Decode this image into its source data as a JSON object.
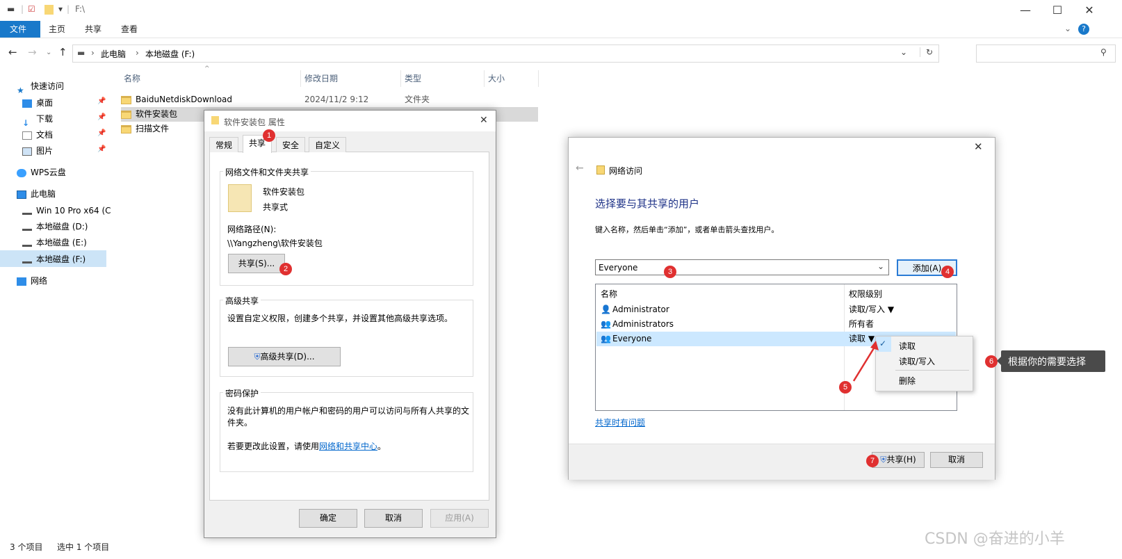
{
  "titlebar": {
    "path": "F:\\",
    "minimize": "—",
    "maximize": "☐",
    "close": "✕"
  },
  "ribbon": {
    "tabs": [
      "文件",
      "主页",
      "共享",
      "查看"
    ]
  },
  "address": {
    "crumbs": [
      "此电脑",
      "本地磁盘 (F:)"
    ]
  },
  "nav": {
    "quick_access": "快速访问",
    "items": [
      "桌面",
      "下载",
      "文档",
      "图片"
    ],
    "wps": "WPS云盘",
    "this_pc": "此电脑",
    "drives": [
      "Win 10 Pro x64 (C",
      "本地磁盘 (D:)",
      "本地磁盘 (E:)",
      "本地磁盘 (F:)"
    ],
    "network": "网络"
  },
  "columns": [
    "名称",
    "修改日期",
    "类型",
    "大小"
  ],
  "files": [
    {
      "name": "BaiduNetdiskDownload",
      "date": "2024/11/2 9:12",
      "type": "文件夹"
    },
    {
      "name": "软件安装包",
      "date": "",
      "type": ""
    },
    {
      "name": "扫描文件",
      "date": "",
      "type": ""
    }
  ],
  "status": {
    "count": "3 个项目",
    "selected": "选中 1 个项目"
  },
  "props": {
    "title": "软件安装包 属性",
    "tabs": [
      "常规",
      "共享",
      "安全",
      "自定义"
    ],
    "net_share_title": "网络文件和文件夹共享",
    "folder_name": "软件安装包",
    "folder_state": "共享式",
    "net_path_label": "网络路径(N):",
    "net_path": "\\\\Yangzheng\\软件安装包",
    "share_btn": "共享(S)...",
    "adv_title": "高级共享",
    "adv_desc": "设置自定义权限，创建多个共享，并设置其他高级共享选项。",
    "adv_btn": "高级共享(D)...",
    "pwd_title": "密码保护",
    "pwd_desc": "没有此计算机的用户帐户和密码的用户可以访问与所有人共享的文件夹。",
    "pwd_change_prefix": "若要更改此设置，请使用",
    "pwd_link": "网络和共享中心",
    "pwd_suffix": "。",
    "ok": "确定",
    "cancel": "取消",
    "apply": "应用(A)"
  },
  "net": {
    "title": "网络访问",
    "heading": "选择要与其共享的用户",
    "desc": "键入名称，然后单击“添加”，或者单击箭头查找用户。",
    "input_value": "Everyone",
    "add_btn": "添加(A)",
    "col_name": "名称",
    "col_level": "权限级别",
    "users": [
      {
        "name": "Administrator",
        "level": "读取/写入 ▼"
      },
      {
        "name": "Administrators",
        "level": "所有者"
      },
      {
        "name": "Everyone",
        "level": "读取 ▼"
      }
    ],
    "menu": [
      "读取",
      "读取/写入",
      "删除"
    ],
    "menu_check": "✓",
    "trouble_link": "共享时有问题",
    "share_btn": "共享(H)",
    "cancel_btn": "取消"
  },
  "badges": [
    "1",
    "2",
    "3",
    "4",
    "5",
    "6",
    "7"
  ],
  "tip": "根据你的需要选择",
  "watermark": "CSDN @奋进的小羊"
}
